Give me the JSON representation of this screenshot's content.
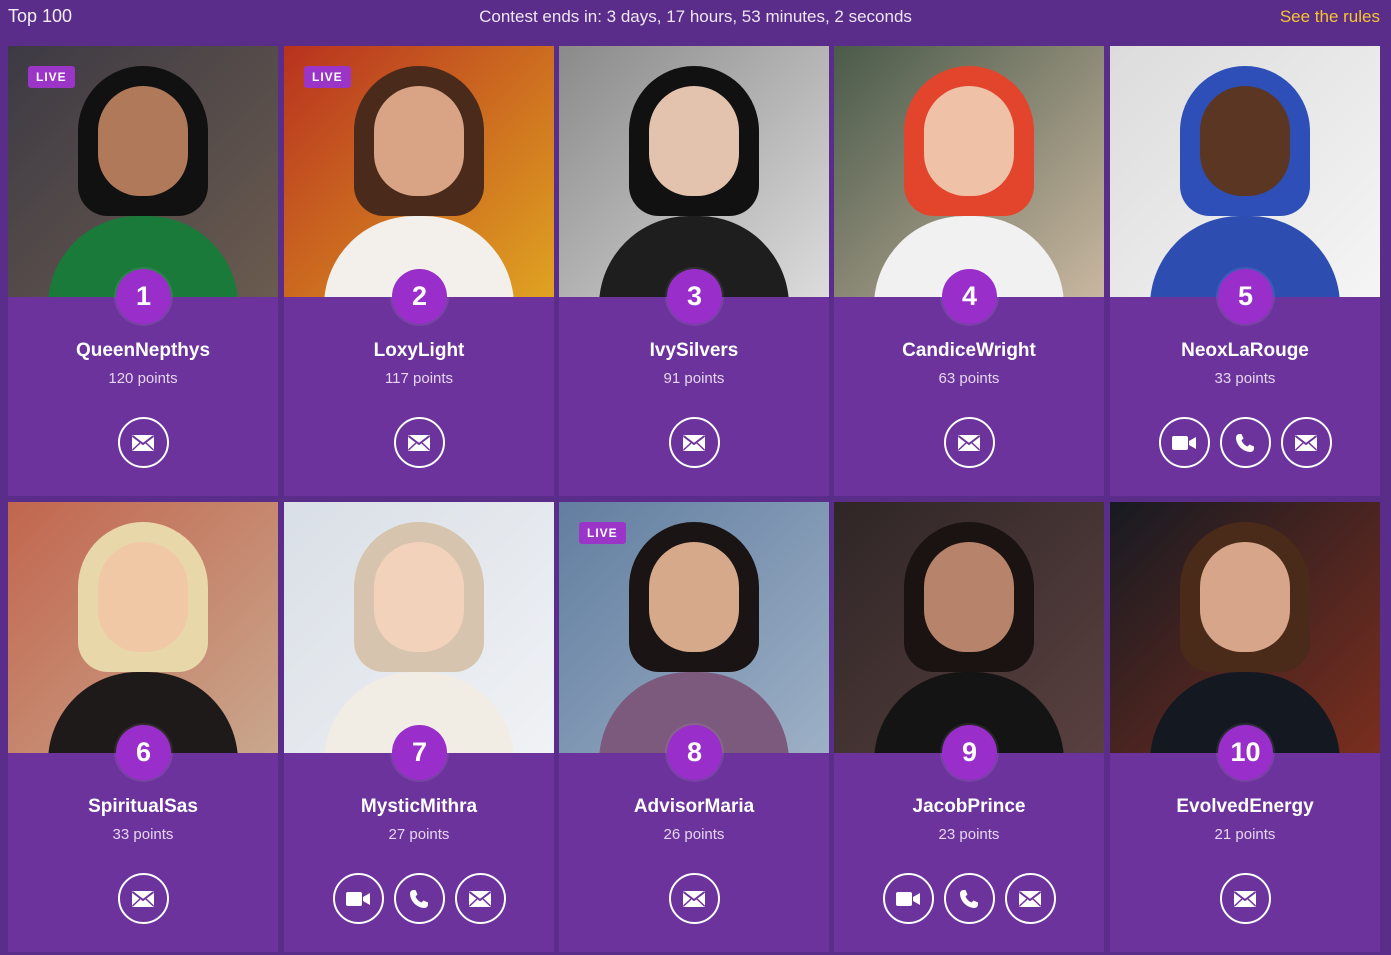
{
  "header": {
    "title": "Top 100",
    "timer_text": "Contest ends in: 3 days, 17 hours, 53 minutes, 2 seconds",
    "rules_link": "See the rules"
  },
  "live_label": "LIVE",
  "colors": {
    "background": "#5a2d8a",
    "card": "#6c339c",
    "rank_badge": "#9a2ecb",
    "live_badge": "#9a35c8",
    "rules_link": "#f6c531"
  },
  "advisors": [
    {
      "rank": "1",
      "name": "QueenNepthys",
      "points": "120 points",
      "live": true,
      "actions": [
        "message"
      ]
    },
    {
      "rank": "2",
      "name": "LoxyLight",
      "points": "117 points",
      "live": true,
      "actions": [
        "message"
      ]
    },
    {
      "rank": "3",
      "name": "IvySilvers",
      "points": "91 points",
      "live": false,
      "actions": [
        "message"
      ]
    },
    {
      "rank": "4",
      "name": "CandiceWright",
      "points": "63 points",
      "live": false,
      "actions": [
        "message"
      ]
    },
    {
      "rank": "5",
      "name": "NeoxLaRouge",
      "points": "33 points",
      "live": false,
      "actions": [
        "video",
        "call",
        "message"
      ]
    },
    {
      "rank": "6",
      "name": "SpiritualSas",
      "points": "33 points",
      "live": false,
      "actions": [
        "message"
      ]
    },
    {
      "rank": "7",
      "name": "MysticMithra",
      "points": "27 points",
      "live": false,
      "actions": [
        "video",
        "call",
        "message"
      ]
    },
    {
      "rank": "8",
      "name": "AdvisorMaria",
      "points": "26 points",
      "live": true,
      "actions": [
        "message"
      ]
    },
    {
      "rank": "9",
      "name": "JacobPrince",
      "points": "23 points",
      "live": false,
      "actions": [
        "video",
        "call",
        "message"
      ]
    },
    {
      "rank": "10",
      "name": "EvolvedEnergy",
      "points": "21 points",
      "live": false,
      "actions": [
        "message"
      ]
    }
  ]
}
